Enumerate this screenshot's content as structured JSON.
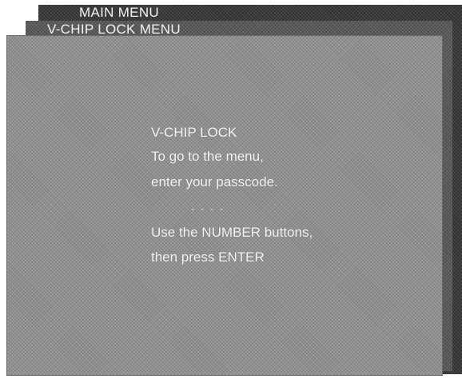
{
  "menus": {
    "main_menu_title": "MAIN MENU",
    "vchip_menu_title": "V-CHIP LOCK MENU"
  },
  "panel": {
    "heading": "V-CHIP LOCK",
    "line1": "To go to the menu,",
    "line2": "enter your passcode.",
    "passcode_slots": [
      "-",
      "-",
      "-",
      "-"
    ],
    "line3": "Use the NUMBER buttons,",
    "line4": "then press ENTER"
  },
  "colors": {
    "main_menu_bg": "#3a3a3a",
    "vchip_menu_bg": "#5a5a5a",
    "panel_bg": "#8f8f8f",
    "text": "#f5f5f5"
  }
}
